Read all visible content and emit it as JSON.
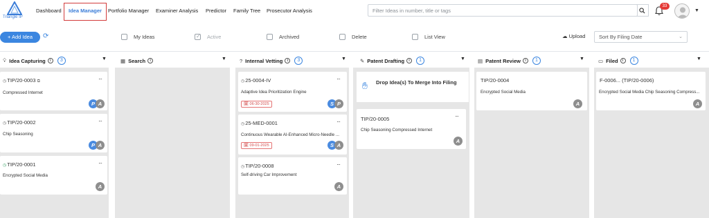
{
  "app": {
    "logo_text": "Triangle IP"
  },
  "nav": {
    "items": [
      {
        "label": "Dashboard"
      },
      {
        "label": "Idea Manager",
        "active": true
      },
      {
        "label": "Portfolio Manager"
      },
      {
        "label": "Examiner Analysis"
      },
      {
        "label": "Predictor"
      },
      {
        "label": "Family Tree"
      },
      {
        "label": "Prosecutor Analysis"
      }
    ],
    "search_placeholder": "Filter Ideas in number, title or tags",
    "notification_count": "33"
  },
  "toolbar": {
    "add_label": "+ Add Idea",
    "filters": [
      {
        "label": "My Ideas",
        "checked": false,
        "disabled": false
      },
      {
        "label": "Active",
        "checked": true,
        "disabled": true
      },
      {
        "label": "Archived",
        "checked": false,
        "disabled": false
      },
      {
        "label": "Delete",
        "checked": false,
        "disabled": false
      },
      {
        "label": "List View",
        "checked": false,
        "disabled": false
      }
    ],
    "upload_label": "Upload",
    "sort_value": "Sort By Filing Date"
  },
  "columns": [
    {
      "title": "Idea Capturing",
      "count": "3"
    },
    {
      "title": "Search",
      "count": ""
    },
    {
      "title": "Internal Vetting",
      "count": "3"
    },
    {
      "title": "Patent Drafting",
      "count": "1"
    },
    {
      "title": "Patent Review",
      "count": "1"
    },
    {
      "title": "Filed",
      "count": "1"
    }
  ],
  "cards": {
    "idea_capturing": [
      {
        "id": "TIP/20-0003",
        "title": "Compressed Internet",
        "avatars": [
          "P",
          "A"
        ]
      },
      {
        "id": "TIP/20-0002",
        "title": "Chip Seasoning",
        "avatars": [
          "P",
          "A"
        ]
      },
      {
        "id": "TIP/20-0001",
        "title": "Encrypted Social Media",
        "avatars": [
          "A"
        ]
      }
    ],
    "internal_vetting": [
      {
        "id": "25-0004-IV",
        "title": "Adaptive Idea Prioritization Engine",
        "date": "06-30-2025",
        "avatars": [
          "S",
          "P"
        ]
      },
      {
        "id": "25-MED-0001",
        "title": "Continuous Wearable AI-Enhanced Micro-Needle ...",
        "date": "09-01-2025",
        "avatars": [
          "S",
          "A"
        ]
      },
      {
        "id": "TIP/20-0008",
        "title": "Self-driving Car Improvement",
        "avatars": [
          "A"
        ]
      }
    ],
    "patent_drafting": {
      "drop_text": "Drop Idea(s) To Merge Into Filing",
      "items": [
        {
          "id": "TIP/20-0005",
          "title": "Chip Seasoning Compressed Internet",
          "avatars": [
            "A"
          ]
        }
      ]
    },
    "patent_review": [
      {
        "id": "TIP/20-0004",
        "title": "Encrypted Social Media",
        "avatars": [
          "A"
        ]
      }
    ],
    "filed": [
      {
        "id": "F-0006... (TIP/20-0006)",
        "title": "Encrypted Social Media Chip Seasoning Compress...",
        "avatars": [
          "A"
        ]
      }
    ]
  },
  "more_glyph": "···",
  "colors": {
    "accent": "#3b86e0",
    "nav_highlight": "#d23a3a",
    "badge": "#e53935",
    "lane_bg": "#e6e6e6",
    "date_badge": "#d24a4a"
  }
}
